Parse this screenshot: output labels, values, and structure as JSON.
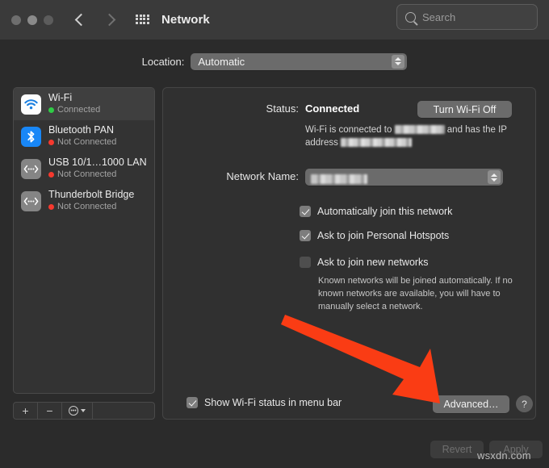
{
  "window": {
    "title": "Network",
    "traffic_lights": [
      "close",
      "minimize",
      "zoom"
    ],
    "back_icon": "chevron-left-icon",
    "forward_icon": "chevron-right-icon",
    "grid_icon": "grid-apps-icon"
  },
  "search": {
    "placeholder": "Search",
    "icon": "search-icon",
    "value": ""
  },
  "location": {
    "label": "Location:",
    "value": "Automatic",
    "options": [
      "Automatic"
    ]
  },
  "sidebar": {
    "services": [
      {
        "name": "Wi-Fi",
        "status": "Connected",
        "status_color": "#2fcc46",
        "icon": "wifi-icon",
        "selected": true
      },
      {
        "name": "Bluetooth PAN",
        "status": "Not Connected",
        "status_color": "#f6392e",
        "icon": "bluetooth-icon",
        "selected": false
      },
      {
        "name": "USB 10/1…1000 LAN",
        "status": "Not Connected",
        "status_color": "#f6392e",
        "icon": "ethernet-icon",
        "selected": false
      },
      {
        "name": "Thunderbolt Bridge",
        "status": "Not Connected",
        "status_color": "#f6392e",
        "icon": "ethernet-icon",
        "selected": false
      }
    ],
    "toolbar": {
      "add_label": "+",
      "remove_label": "−",
      "action_icon": "gear-action-icon",
      "action_glyph": "•••"
    }
  },
  "main": {
    "status_label": "Status:",
    "status_value": "Connected",
    "turn_wifi_off_label": "Turn Wi-Fi Off",
    "status_desc_prefix": "Wi-Fi is connected to",
    "status_desc_middle": "and has the IP",
    "status_desc_suffix": "address",
    "status_desc_network_redacted": true,
    "status_desc_ip_redacted": true,
    "network_name_label": "Network Name:",
    "network_name_value_redacted": true,
    "checkboxes": [
      {
        "label": "Automatically join this network",
        "checked": true
      },
      {
        "label": "Ask to join Personal Hotspots",
        "checked": true
      },
      {
        "label": "Ask to join new networks",
        "checked": false
      }
    ],
    "known_networks_note": "Known networks will be joined automatically. If no known networks are available, you will have to manually select a network.",
    "show_status_checkbox": {
      "label": "Show Wi-Fi status in menu bar",
      "checked": true
    },
    "advanced_label": "Advanced…",
    "help_label": "?"
  },
  "footer": {
    "revert_label": "Revert",
    "apply_label": "Apply",
    "revert_enabled": false,
    "apply_enabled": false
  },
  "annotation": {
    "arrow_color": "#fa3c14",
    "points_to": "advanced-button"
  },
  "watermark": {
    "text": "wsxdn.com"
  }
}
